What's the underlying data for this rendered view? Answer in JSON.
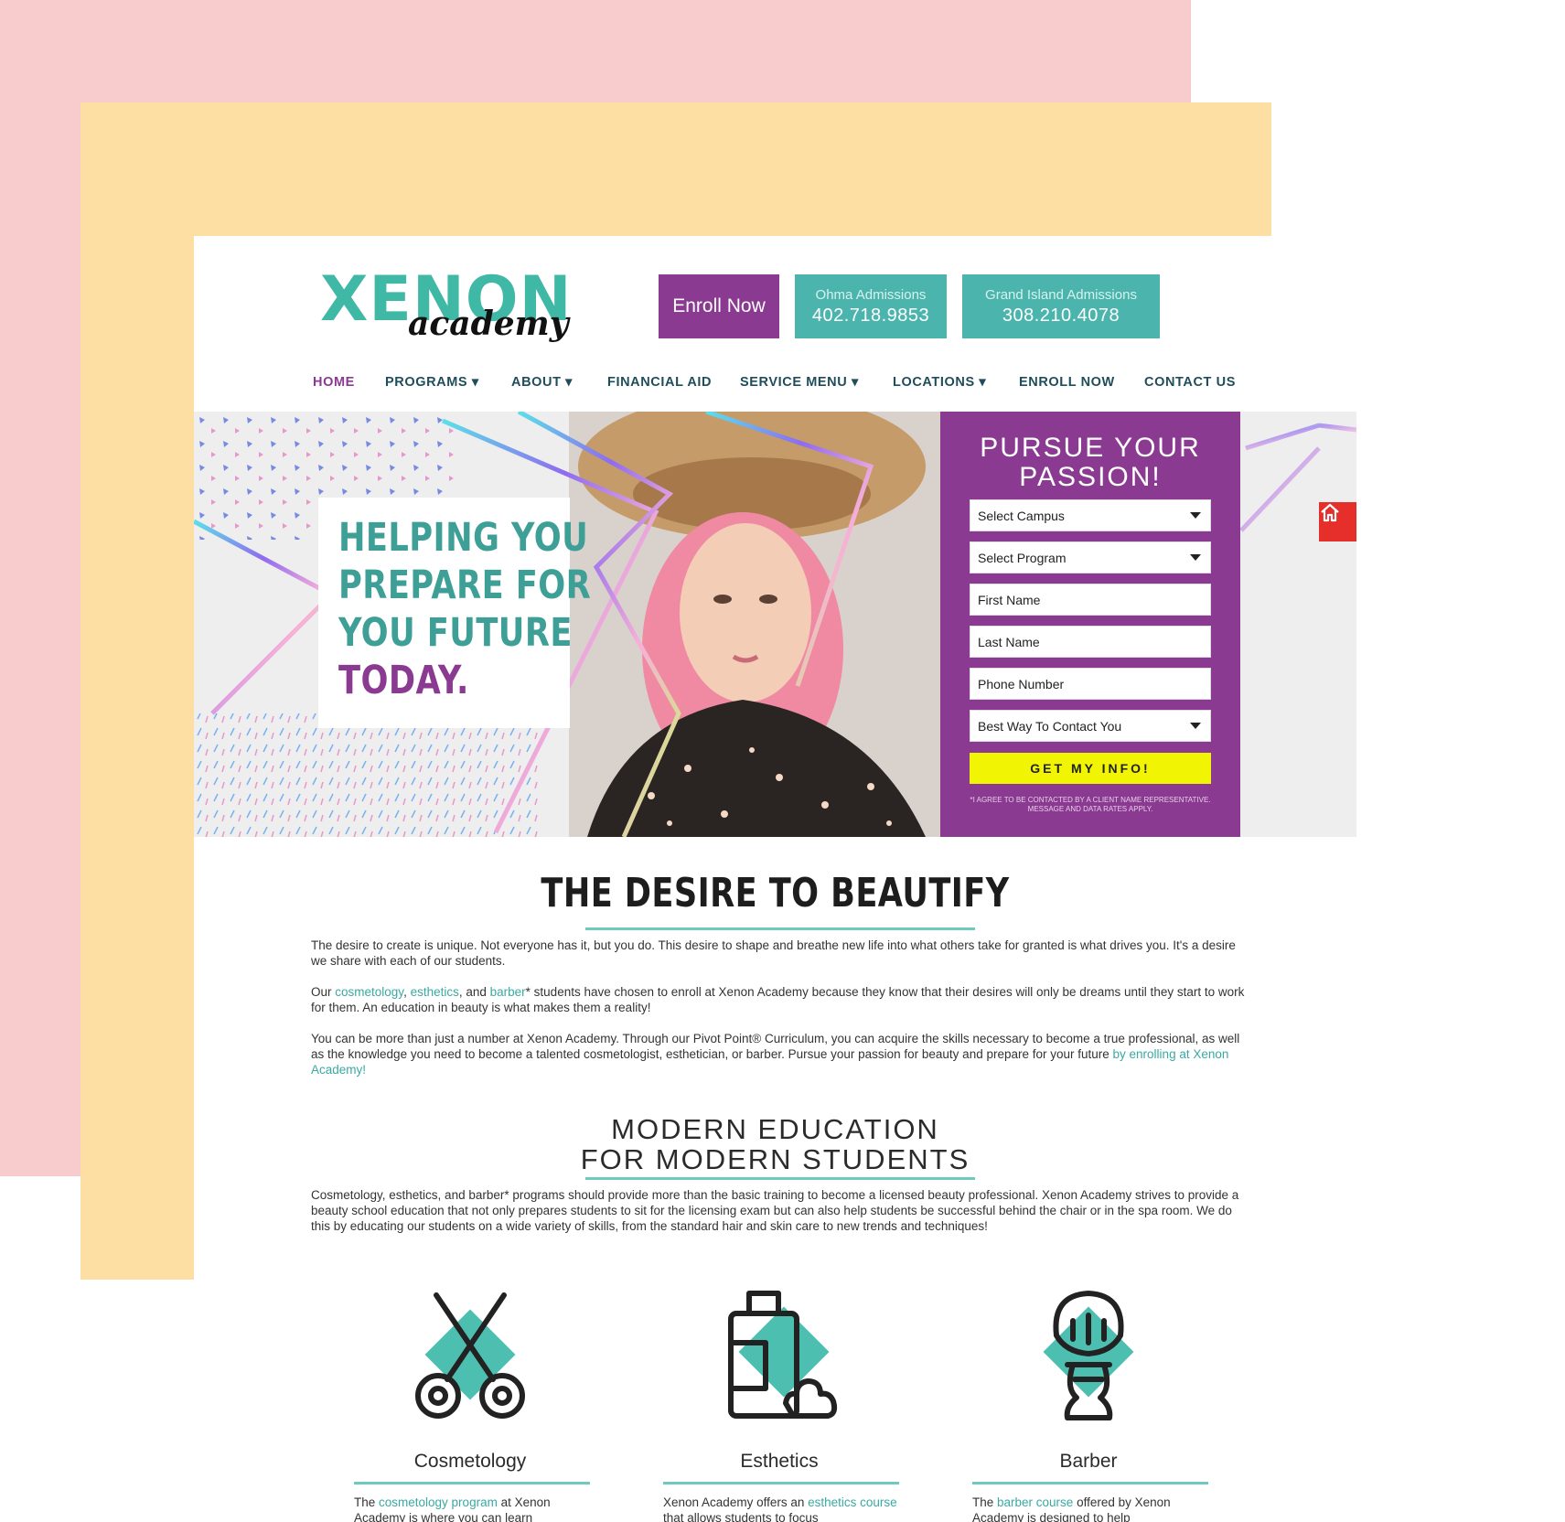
{
  "logo": {
    "main": "XENON",
    "script": "academy"
  },
  "header": {
    "enroll_label": "Enroll Now",
    "omaha": {
      "label": "Ohma Admissions",
      "phone": "402.718.9853"
    },
    "grand_island": {
      "label": "Grand Island Admissions",
      "phone": "308.210.4078"
    }
  },
  "nav": {
    "items": [
      {
        "label": "HOME"
      },
      {
        "label": "PROGRAMS ▾"
      },
      {
        "label": "ABOUT ▾"
      },
      {
        "label": "FINANCIAL AID"
      },
      {
        "label": "SERVICE MENU ▾"
      },
      {
        "label": "LOCATIONS ▾"
      },
      {
        "label": "ENROLL NOW"
      },
      {
        "label": "CONTACT US"
      }
    ]
  },
  "hero": {
    "line1": "HELPING YOU",
    "line2": "PREPARE FOR",
    "line3": "YOU FUTURE",
    "line4": "TODAY."
  },
  "form": {
    "title_line1": "PURSUE YOUR",
    "title_line2": "PASSION!",
    "campus": "Select Campus",
    "program": "Select Program",
    "first_name": "First Name",
    "last_name": "Last Name",
    "phone": "Phone Number",
    "contact": "Best Way To Contact You",
    "submit": "GET MY INFO!",
    "disclaimer": "*I AGREE TO BE CONTACTED BY A CLIENT NAME REPRESENTATIVE. MESSAGE AND DATA RATES APPLY."
  },
  "colors": {
    "teal": "#4bb5ad",
    "purple": "#8b3a91",
    "yellow": "#f1f402",
    "red": "#e62e2b"
  },
  "desire": {
    "title": "THE DESIRE TO BEAUTIFY",
    "p1": "The desire to create is unique. Not everyone has it, but you do. This desire to shape and breathe new life into what others take for granted is what drives you. It's a desire we share with each of our students.",
    "p2_a": "Our ",
    "p2_link1": "cosmetology",
    "p2_b": ", ",
    "p2_link2": "esthetics",
    "p2_c": ", and ",
    "p2_link3": "barber",
    "p2_d": "* students have chosen to enroll at Xenon Academy because they know that their desires will only be dreams until they start to work for them. An education in beauty is what makes them a reality!",
    "p3_a": "You can be more than just a number at Xenon Academy. Through our Pivot Point® Curriculum, you can acquire the skills necessary to become a true professional, as well as the knowledge you need to become a talented cosmetologist, esthetician, or barber. Pursue your passion for beauty and prepare for your future ",
    "p3_link": "by enrolling at Xenon Academy!"
  },
  "modern": {
    "title_line1": "MODERN EDUCATION",
    "title_line2": "FOR MODERN STUDENTS",
    "p1": "Cosmetology, esthetics, and barber* programs should provide more than the basic training to become a licensed beauty professional. Xenon Academy strives to provide a beauty school education that not only prepares students to sit for the licensing exam but can also help students be successful behind the chair or in the spa room. We do this by educating our students on a wide variety of skills, from the standard hair and skin care to new trends and techniques!"
  },
  "services": [
    {
      "name": "Cosmetology",
      "icon": "scissors-icon",
      "d1": "The ",
      "link": "cosmetology program",
      "d2": " at Xenon Academy is where you can learn"
    },
    {
      "name": "Esthetics",
      "icon": "bottle-icon",
      "d1": "Xenon Academy offers an ",
      "link": "esthetics course",
      "d2": " that allows students to focus"
    },
    {
      "name": "Barber",
      "icon": "shaving-brush-icon",
      "d1": "The ",
      "link": "barber course",
      "d2": " offered by Xenon Academy is designed to help"
    }
  ]
}
